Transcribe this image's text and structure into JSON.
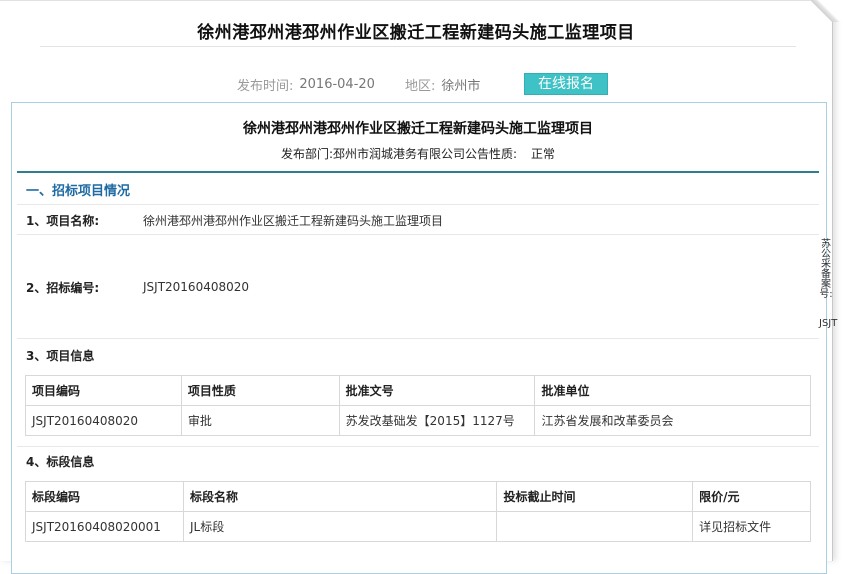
{
  "page_title": "徐州港邳州港邳州作业区搬迁工程新建码头施工监理项目",
  "meta": {
    "publish_label": "发布时间:",
    "publish_date": "2016-04-20",
    "region_label": "地区:",
    "region": "徐州市",
    "register_button": "在线报名"
  },
  "notice": {
    "title": "徐州港邳州港邳州作业区搬迁工程新建码头施工监理项目",
    "dept_label": "发布部门:",
    "dept": "邳州市润城港务有限公司",
    "nature_label": "公告性质:",
    "nature": "正常"
  },
  "section1": {
    "heading": "一、招标项目情况"
  },
  "item1": {
    "label": "1、项目名称:",
    "value": "徐州港邳州港邳州作业区搬迁工程新建码头施工监理项目"
  },
  "item2": {
    "label": "2、招标编号:",
    "value": "JSJT20160408020"
  },
  "item3": {
    "label": "3、项目信息",
    "headers": [
      "项目编码",
      "项目性质",
      "批准文号",
      "批准单位"
    ],
    "row": [
      "JSJT20160408020",
      "审批",
      "苏发改基础发【2015】1127号",
      "江苏省发展和改革委员会"
    ]
  },
  "item4": {
    "label": "4、标段信息",
    "headers": [
      "标段编码",
      "标段名称",
      "投标截止时间",
      "限价/元"
    ],
    "row": [
      "JSJT20160408020001",
      "JL标段",
      "",
      "详见招标文件"
    ]
  },
  "side_label": {
    "text": "苏公采备案号:",
    "code": "JSJT"
  }
}
